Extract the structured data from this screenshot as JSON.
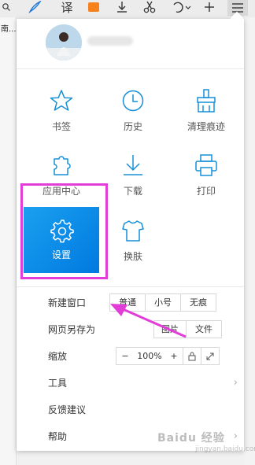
{
  "left_text": "南...",
  "topbar": {
    "icons": [
      "pen-icon",
      "translate-icon",
      "orange-app-icon",
      "download-icon",
      "scissors-icon",
      "undo-icon",
      "add-icon",
      "menu-icon"
    ],
    "translate_label": "译"
  },
  "grid": {
    "bookmarks": "书签",
    "history": "历史",
    "clear_traces": "清理痕迹",
    "app_center": "应用中心",
    "downloads": "下载",
    "print": "打印",
    "settings": "设置",
    "skin": "换肤"
  },
  "menu": {
    "new_window": {
      "label": "新建窗口",
      "options": [
        "普通",
        "小号",
        "无痕"
      ]
    },
    "save_page": {
      "label": "网页另存为",
      "options": [
        "图片",
        "文件"
      ]
    },
    "zoom": {
      "label": "缩放",
      "minus": "−",
      "value": "100%",
      "plus": "+"
    },
    "tools": "工具",
    "feedback": "反馈建议",
    "help": "帮助"
  },
  "watermark": {
    "main": "Baidu 经验",
    "sub": "jingyan.baidu.com"
  },
  "colors": {
    "accent": "#0a8fe8",
    "icon_blue": "#1590d8",
    "highlight": "#e23cd9"
  }
}
